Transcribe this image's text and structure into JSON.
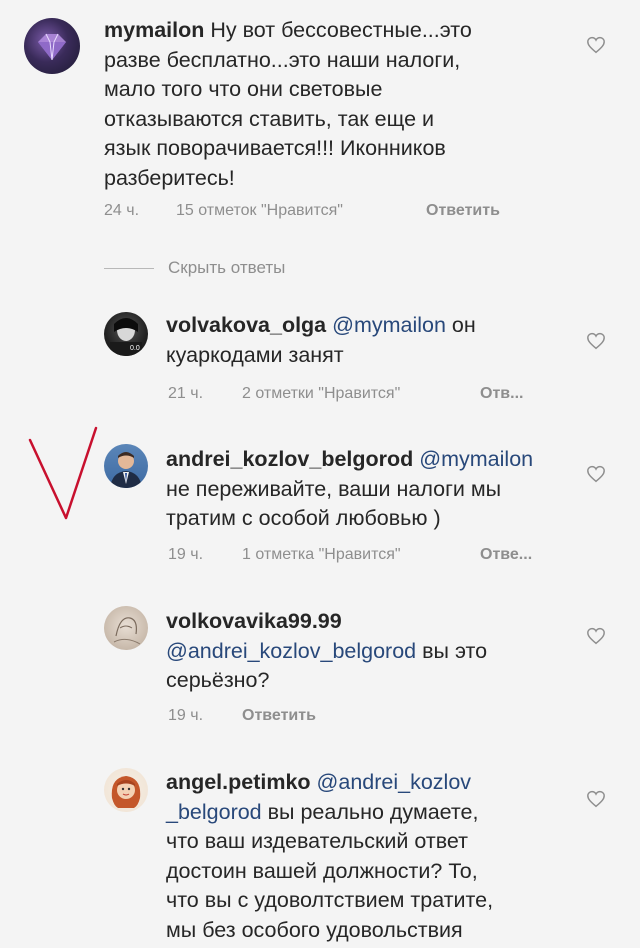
{
  "comments": [
    {
      "username": "mymailon",
      "text_1": " Ну вот бессовестные...это",
      "lines": [
        "разве бесплатно...это наши налоги,",
        "мало того что они световые",
        "отказываются ставить, так еще и",
        "язык поворачивается!!! Иконников",
        "разберитесь!"
      ],
      "time": "24 ч.",
      "likes": "15 отметок \"Нравится\"",
      "reply": "Ответить"
    },
    {
      "username": "volvakova_olga",
      "mention": " @mymailon",
      "text_1": " он",
      "lines": [
        "куаркодами занят"
      ],
      "time": "21 ч.",
      "likes": "2 отметки \"Нравится\"",
      "reply": "Отв..."
    },
    {
      "username": "andrei_kozlov_belgorod",
      "mention": " @mymailon",
      "lines": [
        "не переживайте, ваши налоги мы",
        "тратим с особой любовью )"
      ],
      "time": "19 ч.",
      "likes": "1 отметка \"Нравится\"",
      "reply": "Отве..."
    },
    {
      "username": "volkovavika99.99",
      "mention_line": "@andrei_kozlov_belgorod",
      "text_after_mention": " вы это",
      "lines": [
        "серьёзно?"
      ],
      "time": "19 ч.",
      "reply": "Ответить"
    },
    {
      "username": "angel.petimko",
      "mention": " @andrei_kozlov",
      "mention_cont": "_belgorod",
      "text_after_mention": " вы реально думаете,",
      "lines": [
        "что ваш издевательский ответ",
        "достоин вашей должности?  То,",
        "что вы с удоволтствием тратите,",
        "мы без особого удовольствия"
      ]
    }
  ],
  "hide_replies": "Скрыть ответы",
  "icons": {
    "like": "heart-outline-icon",
    "annotation": "checkmark-annotation"
  },
  "colors": {
    "mention": "#28487a",
    "meta": "#8e8e8e",
    "annotation": "#c8102e"
  }
}
